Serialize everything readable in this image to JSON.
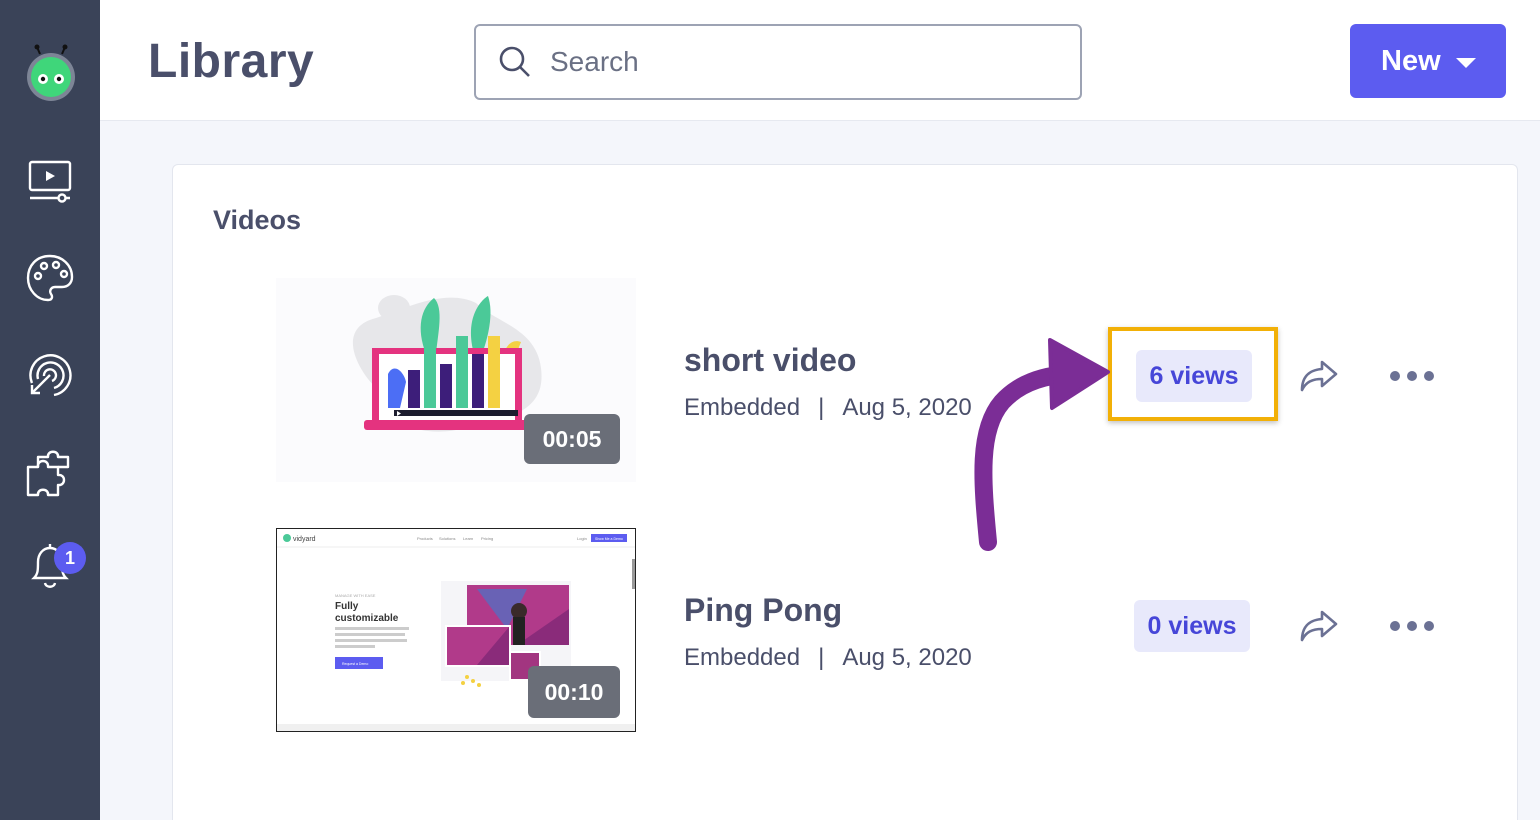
{
  "app": {
    "page_title": "Library",
    "notification_count": "1"
  },
  "search": {
    "placeholder": "Search"
  },
  "new_button": {
    "label": "New"
  },
  "section": {
    "title": "Videos"
  },
  "videos": [
    {
      "title": "short video",
      "type": "Embedded",
      "date": "Aug 5, 2020",
      "duration": "00:05",
      "views": "6 views"
    },
    {
      "title": "Ping Pong",
      "type": "Embedded",
      "date": "Aug 5, 2020",
      "duration": "00:10",
      "views": "0 views"
    }
  ],
  "thumbnail_page": {
    "brand": "vidyard",
    "eyebrow": "MANAGE WITH EASE",
    "headline_1": "Fully",
    "headline_2": "customizable",
    "nav": [
      "Products",
      "Solutions",
      "Learn",
      "Pricing"
    ],
    "login": "Login",
    "cta": "Show Me a Demo",
    "body_button": "Request a Demo"
  },
  "colors": {
    "sidebar": "#3a4358",
    "accent": "#5c5cf0",
    "highlight": "#f2b007",
    "annotation_arrow": "#7b2d96"
  }
}
